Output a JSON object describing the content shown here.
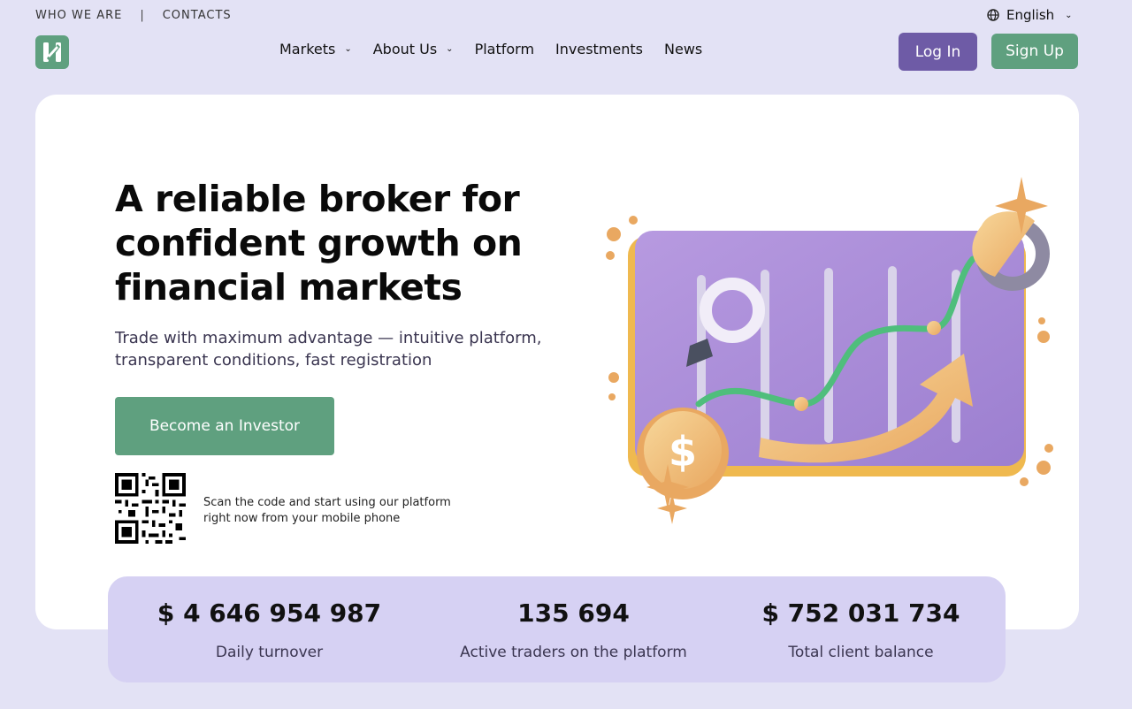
{
  "top_links": {
    "who_we_are": "WHO WE ARE",
    "separator": "|",
    "contacts": "CONTACTS"
  },
  "language": {
    "icon": "globe-icon",
    "selected": "English"
  },
  "nav": {
    "items": [
      {
        "label": "Markets",
        "has_dropdown": true
      },
      {
        "label": "About Us",
        "has_dropdown": true
      },
      {
        "label": "Platform",
        "has_dropdown": false
      },
      {
        "label": "Investments",
        "has_dropdown": false
      },
      {
        "label": "News",
        "has_dropdown": false
      }
    ]
  },
  "auth": {
    "login_label": "Log In",
    "signup_label": "Sign Up"
  },
  "hero": {
    "headline": "A reliable broker for confident growth on financial markets",
    "subtitle": "Trade with maximum advantage — intuitive platform, transparent conditions, fast registration",
    "cta_label": "Become an Investor",
    "qr_text": "Scan the code and start using our platform right now from your mobile phone",
    "illustration_icon": "growth-chart-illustration"
  },
  "stats": [
    {
      "value": "$ 4 646 954 987",
      "label": "Daily turnover"
    },
    {
      "value": "135 694",
      "label": "Active traders on the platform"
    },
    {
      "value": "$ 752 031 734",
      "label": "Total client balance"
    }
  ],
  "colors": {
    "background": "#e3e2f5",
    "primary_green": "#5fa07f",
    "primary_purple": "#6e5ba6",
    "stats_background": "#d6d1f3"
  }
}
